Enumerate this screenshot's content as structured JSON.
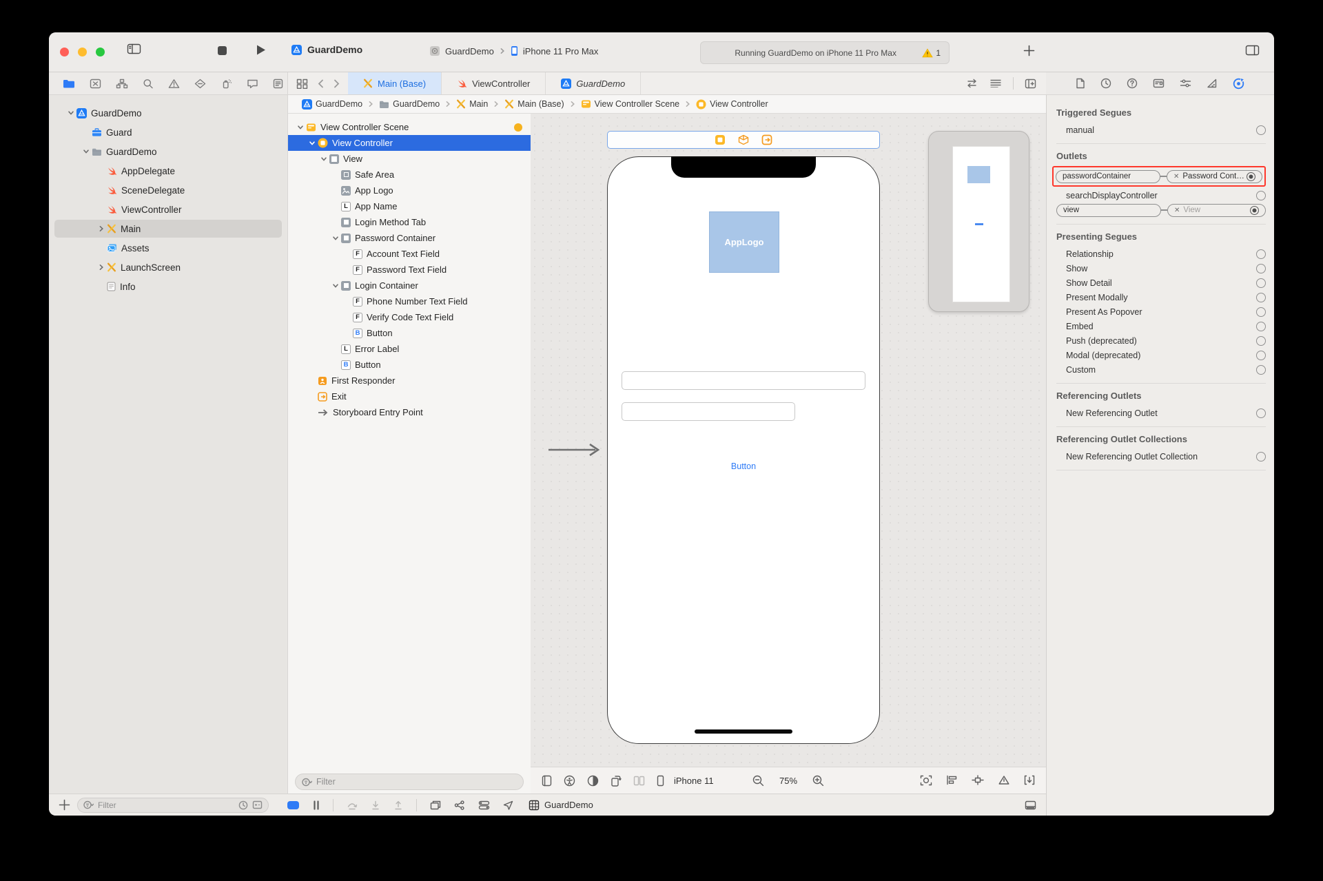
{
  "window": {
    "title": "GuardDemo",
    "scheme": {
      "project": "GuardDemo",
      "device": "iPhone 11 Pro Max"
    },
    "status": {
      "text": "Running GuardDemo on iPhone 11 Pro Max",
      "warning_count": "1"
    }
  },
  "navigator": {
    "items": [
      {
        "label": "GuardDemo",
        "icon": "app",
        "indent": 0,
        "chevron": "down"
      },
      {
        "label": "Guard",
        "icon": "toolbox",
        "indent": 1,
        "chevron": "none"
      },
      {
        "label": "GuardDemo",
        "icon": "folder",
        "indent": 1,
        "chevron": "down"
      },
      {
        "label": "AppDelegate",
        "icon": "swift",
        "indent": 2,
        "chevron": "none"
      },
      {
        "label": "SceneDelegate",
        "icon": "swift",
        "indent": 2,
        "chevron": "none"
      },
      {
        "label": "ViewController",
        "icon": "swift",
        "indent": 2,
        "chevron": "none"
      },
      {
        "label": "Main",
        "icon": "storyboard",
        "indent": 2,
        "chevron": "right",
        "selected": true
      },
      {
        "label": "Assets",
        "icon": "assets",
        "indent": 2,
        "chevron": "none"
      },
      {
        "label": "LaunchScreen",
        "icon": "storyboard",
        "indent": 2,
        "chevron": "right"
      },
      {
        "label": "Info",
        "icon": "info",
        "indent": 2,
        "chevron": "none"
      }
    ]
  },
  "tabs": [
    {
      "label": "Main (Base)",
      "icon": "storyboard",
      "selected": true
    },
    {
      "label": "ViewController",
      "icon": "swift",
      "selected": false
    },
    {
      "label": "GuardDemo",
      "icon": "app",
      "selected": false,
      "italic": true
    }
  ],
  "breadcrumb": [
    {
      "label": "GuardDemo",
      "icon": "app"
    },
    {
      "label": "GuardDemo",
      "icon": "folder"
    },
    {
      "label": "Main",
      "icon": "storyboard"
    },
    {
      "label": "Main (Base)",
      "icon": "storyboard"
    },
    {
      "label": "View Controller Scene",
      "icon": "scene"
    },
    {
      "label": "View Controller",
      "icon": "vc"
    }
  ],
  "outline": {
    "filter_placeholder": "Filter",
    "rows": [
      {
        "label": "View Controller Scene",
        "icon": "scene",
        "indent": 0,
        "chevron": "down",
        "dot": true
      },
      {
        "label": "View Controller",
        "icon": "vc",
        "indent": 1,
        "chevron": "down",
        "selected": true
      },
      {
        "label": "View",
        "icon": "view",
        "indent": 2,
        "chevron": "down"
      },
      {
        "label": "Safe Area",
        "icon": "safearea",
        "indent": 3,
        "chevron": "none"
      },
      {
        "label": "App Logo",
        "icon": "image",
        "indent": 3,
        "chevron": "none"
      },
      {
        "label": "App Name",
        "icon": "L",
        "indent": 3,
        "chevron": "none"
      },
      {
        "label": "Login Method Tab",
        "icon": "container",
        "indent": 3,
        "chevron": "none"
      },
      {
        "label": "Password Container",
        "icon": "container",
        "indent": 3,
        "chevron": "down"
      },
      {
        "label": "Account Text Field",
        "icon": "F",
        "indent": 4,
        "chevron": "none"
      },
      {
        "label": "Password Text Field",
        "icon": "F",
        "indent": 4,
        "chevron": "none"
      },
      {
        "label": "Login Container",
        "icon": "container",
        "indent": 3,
        "chevron": "down"
      },
      {
        "label": "Phone Number Text Field",
        "icon": "F",
        "indent": 4,
        "chevron": "none"
      },
      {
        "label": "Verify Code Text Field",
        "icon": "F",
        "indent": 4,
        "chevron": "none"
      },
      {
        "label": "Button",
        "icon": "B",
        "indent": 4,
        "chevron": "none"
      },
      {
        "label": "Error Label",
        "icon": "L",
        "indent": 3,
        "chevron": "none"
      },
      {
        "label": "Button",
        "icon": "B",
        "indent": 3,
        "chevron": "none"
      },
      {
        "label": "First Responder",
        "icon": "responder",
        "indent": 1,
        "chevron": "none"
      },
      {
        "label": "Exit",
        "icon": "exit",
        "indent": 1,
        "chevron": "none"
      },
      {
        "label": "Storyboard Entry Point",
        "icon": "entry",
        "indent": 1,
        "chevron": "none"
      }
    ]
  },
  "canvas": {
    "app_logo_label": "AppLogo",
    "button_label": "Button",
    "device_bar": {
      "device": "iPhone 11",
      "zoom_level": "75%"
    }
  },
  "inspector": {
    "triggered_segues": {
      "title": "Triggered Segues",
      "items": [
        {
          "label": "manual"
        }
      ]
    },
    "outlets": {
      "title": "Outlets",
      "rows": [
        {
          "type": "pair",
          "left": "passwordContainer",
          "right": "Password Cont…",
          "highlighted": true,
          "connected": true
        },
        {
          "type": "plain",
          "label": "searchDisplayController"
        },
        {
          "type": "pair",
          "left": "view",
          "right": "View",
          "highlighted": false,
          "connected": true,
          "dimmed": true
        }
      ]
    },
    "presenting_segues": {
      "title": "Presenting Segues",
      "items": [
        "Relationship",
        "Show",
        "Show Detail",
        "Present Modally",
        "Present As Popover",
        "Embed",
        "Push (deprecated)",
        "Modal (deprecated)",
        "Custom"
      ]
    },
    "referencing_outlets": {
      "title": "Referencing Outlets",
      "items": [
        "New Referencing Outlet"
      ]
    },
    "referencing_outlet_collections": {
      "title": "Referencing Outlet Collections",
      "items": [
        "New Referencing Outlet Collection"
      ]
    }
  },
  "bottom_bar": {
    "filter_placeholder": "Filter",
    "project_label": "GuardDemo"
  }
}
